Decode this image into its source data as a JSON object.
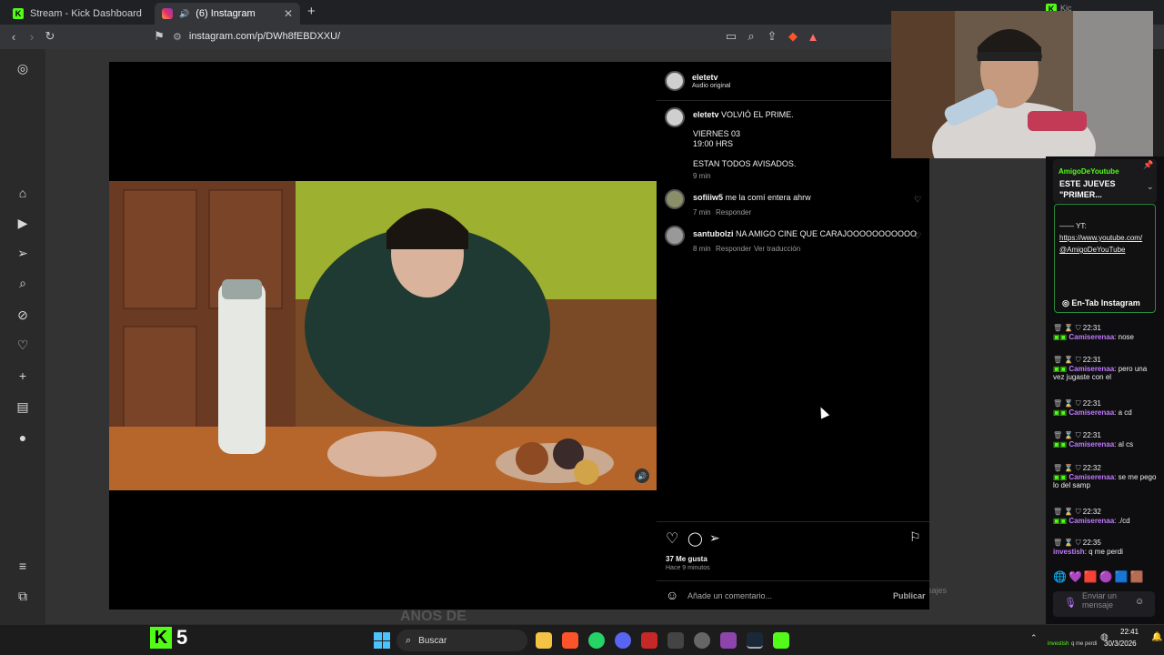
{
  "browser": {
    "tabs": [
      {
        "label": "Stream - Kick Dashboard",
        "active": false
      },
      {
        "label": "(6) Instagram",
        "active": true
      }
    ],
    "url": "instagram.com/p/DWh8fEBDXXU/",
    "second_window_tab": "Kic"
  },
  "post": {
    "author": "eletetv",
    "audio": "Audio original",
    "caption_author": "eletetv",
    "caption_line1": "VOLVIÓ EL PRIME.",
    "caption_line2": "VIERNES 03",
    "caption_line3": "19:00 HRS",
    "caption_line4": "ESTAN TODOS AVISADOS.",
    "caption_time": "9 min",
    "comments": [
      {
        "user": "sofiiiw5",
        "text": "me la comí entera ahrw",
        "time": "7 min",
        "reply": "Responder",
        "translate": ""
      },
      {
        "user": "santubolzi",
        "text": "NA AMIGO CINE QUE CARAJOOOOOOOOOOO",
        "time": "8 min",
        "reply": "Responder",
        "translate": "Ver traducción"
      }
    ],
    "likes": "37 Me gusta",
    "posted": "Hace 9 minutos",
    "comment_placeholder": "Añade un comentario...",
    "publish": "Publicar",
    "behind_text": "AÑOS DE",
    "behind_messages": "sajes"
  },
  "chat": {
    "pinned_user": "AmigoDeYoutube",
    "pinned_title": "ESTE JUEVES \"PRIMER...",
    "pinned_yt": "—— YT:",
    "pinned_link1": "https://www.youtube.com/",
    "pinned_link2": "@AmigoDeYouTube",
    "entab": "En-Tab Instagram",
    "messages": [
      {
        "time": "22:31",
        "user": "Camiserenaa",
        "text": ": nose"
      },
      {
        "time": "22:31",
        "user": "Camiserenaa",
        "text": ": pero una vez jugaste con el"
      },
      {
        "time": "22:31",
        "user": "Camiserenaa",
        "text": ": a cd"
      },
      {
        "time": "22:31",
        "user": "Camiserenaa",
        "text": ": al cs"
      },
      {
        "time": "22:32",
        "user": "Camiserenaa",
        "text": ": se me pego lo del samp"
      },
      {
        "time": "22:32",
        "user": "Camiserenaa",
        "text": ": ./cd"
      },
      {
        "time": "22:35",
        "user": "investish",
        "text": ": q me perdi"
      }
    ],
    "send_placeholder": "Enviar un mensaje",
    "partial_user": "Camiserenaa"
  },
  "overlay": {
    "kick_count": "5"
  },
  "taskbar": {
    "search": "Buscar",
    "time": "22:41",
    "date": "30/3/2026",
    "tray_label1": "investish",
    "tray_label2": "q me perdi"
  },
  "colors": {
    "kick_green": "#53fc18",
    "chat_name": "#c27bff",
    "ig_bg": "#000000"
  }
}
